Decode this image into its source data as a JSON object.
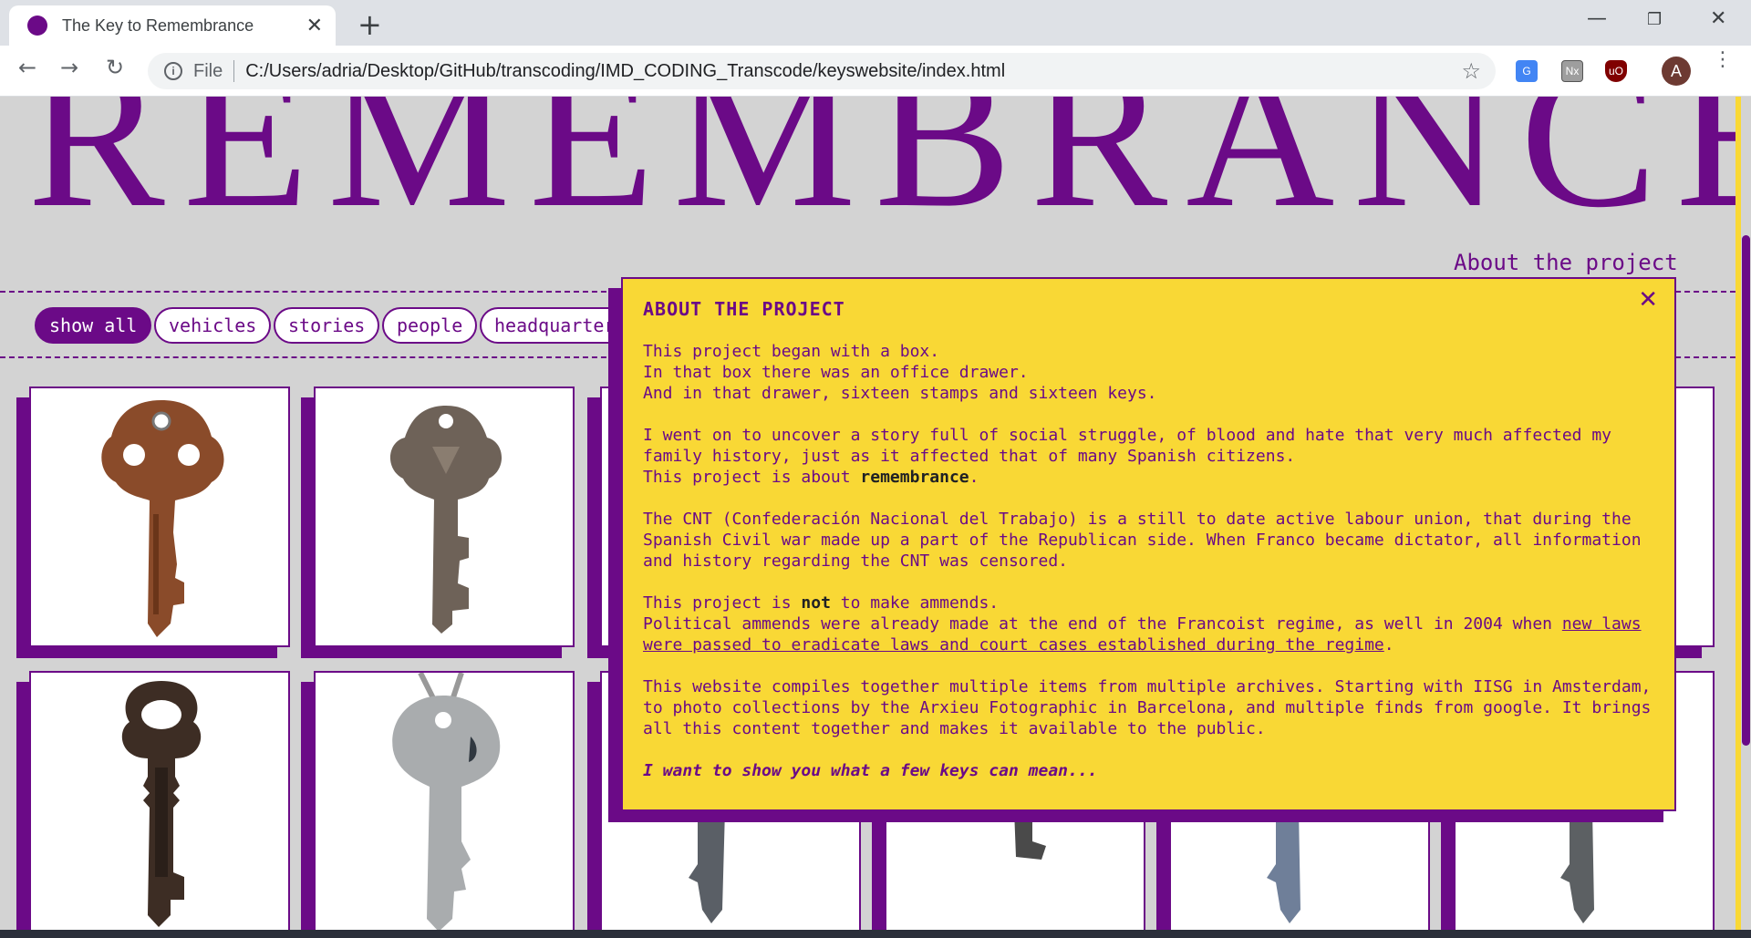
{
  "browser": {
    "tab_title": "The Key to Remembrance",
    "tab_close": "✕",
    "new_tab": "+",
    "window_min": "—",
    "window_max": "❐",
    "window_close": "✕",
    "nav_back": "←",
    "nav_forward": "→",
    "nav_reload": "↻",
    "info_icon_glyph": "i",
    "file_label": "File",
    "url": "C:/Users/adria/Desktop/GitHub/transcoding/IMD_CODING_Transcode/keyswebsite/index.html",
    "star_glyph": "☆",
    "profile_initial": "A",
    "ext_translate": "G",
    "ext_nx": "Nx",
    "ext_ublock": "uO",
    "menu_glyph": "⋮"
  },
  "page": {
    "hero_title": "REMEMBRANCE",
    "about_link": "About the project",
    "filters": [
      "show all",
      "vehicles",
      "stories",
      "people",
      "headquarters"
    ],
    "colors": {
      "purple": "#6b0a87",
      "yellow": "#f9d835",
      "background": "#d3d3d3"
    }
  },
  "modal": {
    "title": "ABOUT THE PROJECT",
    "close": "✕",
    "p1_line1": "This project began with a box.",
    "p1_line2": "In that box there was an office drawer.",
    "p1_line3": "And in that drawer, sixteen stamps and sixteen keys.",
    "p2_text": "I went on to uncover a story full of social struggle, of blood and hate that very much affected my family history, just as it affected that of many Spanish citizens.",
    "p2_line2_pre": "This project is about ",
    "p2_line2_bold": "remembrance",
    "p2_line2_post": ".",
    "p3_text": "The CNT (Confederación Nacional del Trabajo) is a still to date active labour union, that during the Spanish Civil war made up a part of the Republican side. When Franco became dictator, all information and history regarding the CNT was censored.",
    "p4_pre": "This project is ",
    "p4_bold": "not",
    "p4_post": " to make ammends.",
    "p4_line2_pre": "Political ammends were already made at the end of the Francoist regime, as well in 2004 when ",
    "p4_link": "new laws were passed to eradicate laws and court cases established during the regime",
    "p4_line2_post": ".",
    "p5_text": "This website compiles together multiple items from multiple archives. Starting with IISG in Amsterdam, to photo collections by the Arxieu Fotographic in Barcelona, and multiple finds from google. It brings all this content together and makes it available to the public.",
    "tagline": "I want to show you what a few keys can mean..."
  }
}
